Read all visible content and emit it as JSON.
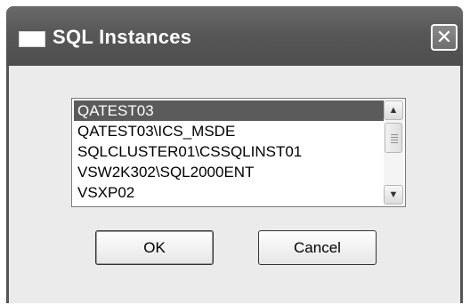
{
  "window": {
    "title": "SQL Instances",
    "close_symbol": "✕",
    "icon": "window-icon"
  },
  "instances": {
    "selected_index": 0,
    "items": [
      "QATEST03",
      "QATEST03\\ICS_MSDE",
      "SQLCLUSTER01\\CSSQLINST01",
      "VSW2K302\\SQL2000ENT",
      "VSXP02"
    ]
  },
  "scrollbar": {
    "up_symbol": "▲",
    "down_symbol": "▼"
  },
  "buttons": {
    "ok_label": "OK",
    "cancel_label": "Cancel"
  },
  "colors": {
    "titlebar": "#575757",
    "selection": "#5b5b5b",
    "client": "#ebebeb"
  }
}
